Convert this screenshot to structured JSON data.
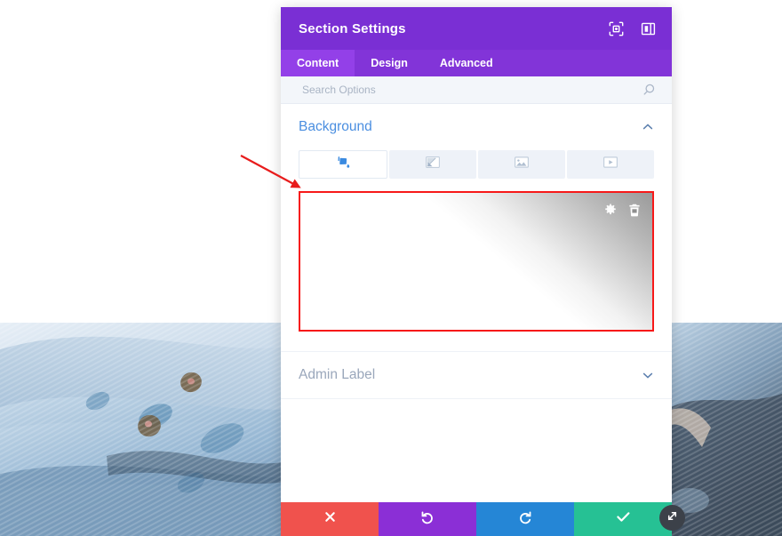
{
  "window": {
    "title": "Section Settings",
    "header_icons": [
      {
        "name": "focus-mode-icon",
        "label": "Focus Mode"
      },
      {
        "name": "panel-layout-icon",
        "label": "Panel Layout"
      }
    ]
  },
  "tabs": [
    {
      "id": "content",
      "label": "Content",
      "active": true
    },
    {
      "id": "design",
      "label": "Design",
      "active": false
    },
    {
      "id": "advanced",
      "label": "Advanced",
      "active": false
    }
  ],
  "search": {
    "value": "",
    "placeholder": "Search Options",
    "icon": "search-icon"
  },
  "sections": [
    {
      "id": "background",
      "title": "Background",
      "expanded": true,
      "chevron": "chevron-up-icon"
    },
    {
      "id": "admin_label",
      "title": "Admin Label",
      "expanded": false,
      "chevron": "chevron-down-icon"
    }
  ],
  "background": {
    "type_tabs": [
      {
        "id": "color",
        "icon": "paint-bucket-icon",
        "label": "Background Color",
        "active": true
      },
      {
        "id": "gradient",
        "icon": "gradient-icon",
        "label": "Background Gradient",
        "active": false
      },
      {
        "id": "image",
        "icon": "image-icon",
        "label": "Background Image",
        "active": false
      },
      {
        "id": "video",
        "icon": "video-icon",
        "label": "Background Video",
        "active": false
      }
    ],
    "preview": {
      "label": "Background gradient preview",
      "gradient_start": "#ffffff",
      "gradient_end": "#9a9a9a",
      "actions": [
        {
          "id": "settings",
          "icon": "gear-icon",
          "label": "Gradient Settings"
        },
        {
          "id": "delete",
          "icon": "trash-icon",
          "label": "Delete Gradient"
        }
      ]
    }
  },
  "annotation": {
    "type": "arrow",
    "color": "#e81c1c",
    "points_to": "background-gradient-preview"
  },
  "footer": {
    "buttons": [
      {
        "id": "cancel",
        "icon": "close-icon",
        "label": "Discard Changes",
        "color": "#f0524d"
      },
      {
        "id": "undo",
        "icon": "undo-icon",
        "label": "Undo",
        "color": "#8b2fd6"
      },
      {
        "id": "redo",
        "icon": "redo-icon",
        "label": "Redo",
        "color": "#2586d6"
      },
      {
        "id": "save",
        "icon": "checkmark-icon",
        "label": "Save Changes",
        "color": "#26c194"
      }
    ]
  },
  "resize_handle": {
    "icon": "resize-diagonal-icon",
    "label": "Resize Panel"
  },
  "page_background": {
    "description": "Folded blue denim jeans fabric photograph",
    "top_color": "#ffffff"
  },
  "colors": {
    "header_purple": "#7a2fd4",
    "tabbar_purple": "#8234d8",
    "active_tab_purple": "#9340e8",
    "accent_blue": "#4a8ee0",
    "annotation_red": "#f71919"
  }
}
